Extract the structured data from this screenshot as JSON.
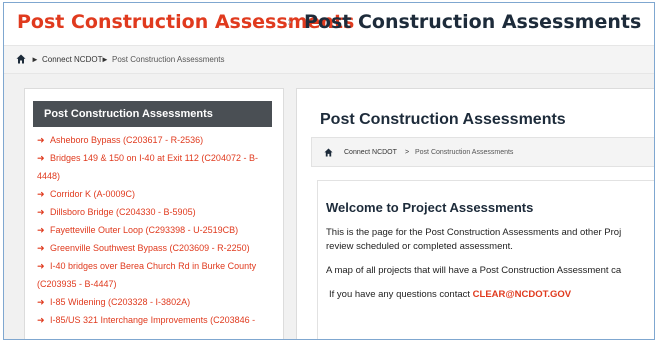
{
  "header": {
    "title_accent": "Post Construction Assessments",
    "separator": "›",
    "title_main": "Post Construction Assessments"
  },
  "top_breadcrumb": {
    "home_icon": "home-icon",
    "items": [
      "Connect NCDOT",
      "Post Construction Assessments"
    ]
  },
  "sidebar": {
    "heading": "Post Construction Assessments",
    "bullet_icon": "arrow-right-icon",
    "items": [
      "Asheboro Bypass (C203617 - R-2536)",
      "Bridges 149 & 150 on I-40 at Exit 112 (C204072 - B-",
      "4448)",
      "Corridor K (A-0009C)",
      "Dillsboro Bridge (C204330 - B-5905)",
      "Fayetteville Outer Loop (C293398 - U-2519CB)",
      "Greenville Southwest Bypass (C203609 - R-2250)",
      "I-40 bridges over Berea Church Rd in Burke County",
      "(C203935 - B-4447)",
      "I-85 Widening (C203328 - I-3802A)",
      "I-85/US 321 Interchange Improvements (C203846 -"
    ]
  },
  "main": {
    "title": "Post Construction Assessments",
    "breadcrumb": {
      "items": [
        "Connect NCDOT",
        ">",
        "Post Construction Assessments"
      ]
    },
    "welcome": {
      "title": "Welcome to Project Assessments",
      "p1": "This is the page for the Post Construction Assessments and other Proj",
      "p1b": "review scheduled or completed assessment.",
      "p2": "A map of all projects that will have a Post Construction Assessment ca",
      "p3_prefix": "If you have any questions contact",
      "email": "CLEAR@NCDOT.GOV"
    }
  },
  "colors": {
    "accent": "#e03a1e",
    "heading": "#1d2b3a",
    "sidebar_head_bg": "#4a4f54"
  }
}
